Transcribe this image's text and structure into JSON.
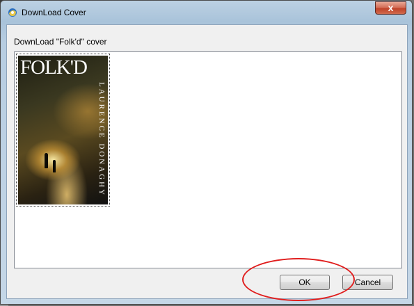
{
  "window": {
    "title": "DownLoad Cover",
    "close_glyph": "x"
  },
  "dialog": {
    "label": "DownLoad \"Folk'd\" cover",
    "cover": {
      "title_text": "FOLK'D",
      "author_text": "LAURENCE DONAGHY"
    },
    "ok_label": "OK",
    "cancel_label": "Cancel"
  },
  "colors": {
    "annotation": "#e01e1e",
    "close_button": "#c0432a",
    "titlebar": "#a9c3da"
  },
  "icons": {
    "app_icon": "app-icon",
    "close": "close-icon"
  }
}
